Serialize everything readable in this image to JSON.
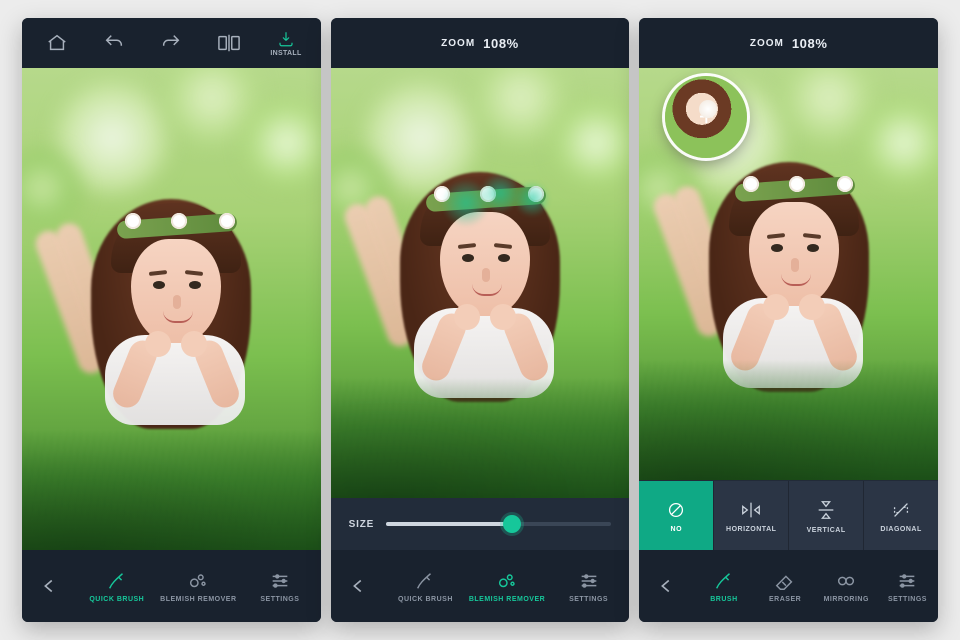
{
  "colors": {
    "accent": "#16c79a"
  },
  "topbar1": {
    "install_label": "INSTALL"
  },
  "zoombar": {
    "label": "ZOOM",
    "value": "108%"
  },
  "screen1": {
    "back": "←",
    "tools": [
      {
        "label": "QUICK BRUSH",
        "active": true
      },
      {
        "label": "BLEMISH REMOVER",
        "active": false
      },
      {
        "label": "SETTINGS",
        "active": false
      }
    ]
  },
  "screen2": {
    "size_label": "SIZE",
    "tools": [
      {
        "label": "QUICK BRUSH",
        "active": false
      },
      {
        "label": "BLEMISH REMOVER",
        "active": true
      },
      {
        "label": "SETTINGS",
        "active": false
      }
    ]
  },
  "screen3": {
    "mirror_options": [
      {
        "label": "NO",
        "selected": true
      },
      {
        "label": "HORIZONTAL",
        "selected": false
      },
      {
        "label": "VERTICAL",
        "selected": false
      },
      {
        "label": "DIAGONAL",
        "selected": false
      }
    ],
    "tools": [
      {
        "label": "BRUSH",
        "active": true
      },
      {
        "label": "ERASER",
        "active": false
      },
      {
        "label": "MIRRORING",
        "active": false
      },
      {
        "label": "SETTINGS",
        "active": false
      }
    ]
  }
}
